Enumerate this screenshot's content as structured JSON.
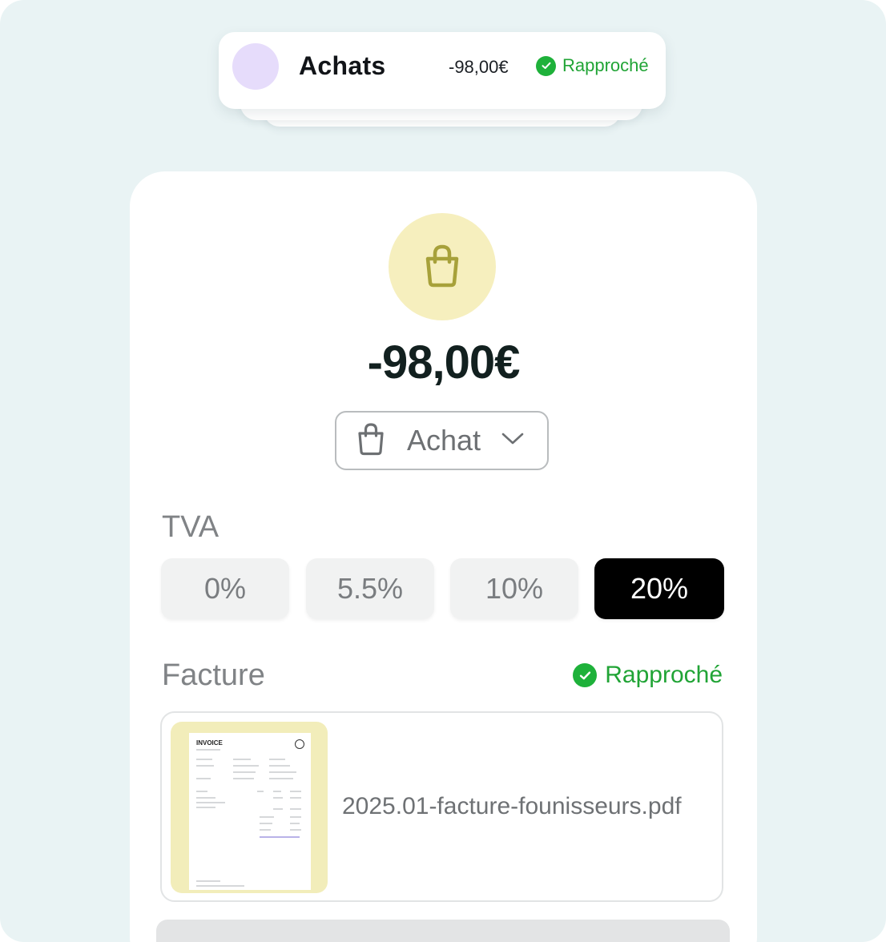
{
  "notification": {
    "title": "Achats",
    "amount": "-98,00€",
    "status": "Rapproché",
    "avatar_color": "#e6dcfb"
  },
  "transaction": {
    "icon": "shopping-bag-icon",
    "amount": "-98,00€",
    "category": {
      "icon": "shopping-bag-icon",
      "label": "Achat"
    }
  },
  "tva": {
    "label": "TVA",
    "rates": [
      "0%",
      "5.5%",
      "10%",
      "20%"
    ],
    "selected": "20%"
  },
  "invoice": {
    "label": "Facture",
    "status": "Rapproché",
    "file_name": "2025.01-facture-founisseurs.pdf",
    "thumbnail_title": "INVOICE"
  },
  "colors": {
    "status_green": "#1eb13a",
    "bag_circle": "#f6efbe",
    "bag_icon": "#a7a13a",
    "selected_rate": "#000000"
  }
}
